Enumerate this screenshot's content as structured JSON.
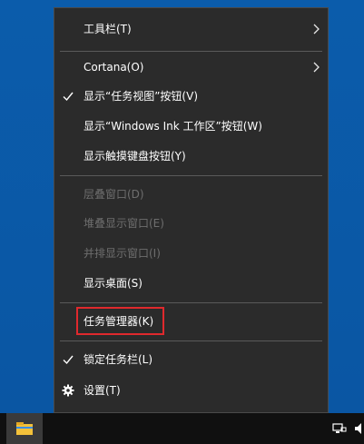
{
  "context_menu": {
    "items": [
      {
        "label": "工具栏(T)",
        "has_submenu": true,
        "checked": false,
        "enabled": true
      },
      {
        "label": "Cortana(O)",
        "has_submenu": true,
        "checked": false,
        "enabled": true
      },
      {
        "label": "显示“任务视图”按钮(V)",
        "has_submenu": false,
        "checked": true,
        "enabled": true
      },
      {
        "label": "显示“Windows Ink 工作区”按钮(W)",
        "has_submenu": false,
        "checked": false,
        "enabled": true
      },
      {
        "label": "显示触摸键盘按钮(Y)",
        "has_submenu": false,
        "checked": false,
        "enabled": true
      },
      {
        "label": "层叠窗口(D)",
        "has_submenu": false,
        "checked": false,
        "enabled": false
      },
      {
        "label": "堆叠显示窗口(E)",
        "has_submenu": false,
        "checked": false,
        "enabled": false
      },
      {
        "label": "并排显示窗口(I)",
        "has_submenu": false,
        "checked": false,
        "enabled": false
      },
      {
        "label": "显示桌面(S)",
        "has_submenu": false,
        "checked": false,
        "enabled": true
      },
      {
        "label": "任务管理器(K)",
        "has_submenu": false,
        "checked": false,
        "enabled": true,
        "highlighted": true
      },
      {
        "label": "锁定任务栏(L)",
        "has_submenu": false,
        "checked": true,
        "enabled": true
      },
      {
        "label": "设置(T)",
        "has_submenu": false,
        "checked": false,
        "enabled": true,
        "icon": "gear-icon"
      }
    ]
  },
  "taskbar": {
    "app_icon": "file-explorer-icon",
    "tray_icons": [
      "network-icon",
      "volume-icon"
    ]
  },
  "colors": {
    "menu_bg": "#2b2b2b",
    "highlight_border": "#e0292d",
    "desktop_bg": "#0b5cab",
    "taskbar_bg": "#101010"
  }
}
